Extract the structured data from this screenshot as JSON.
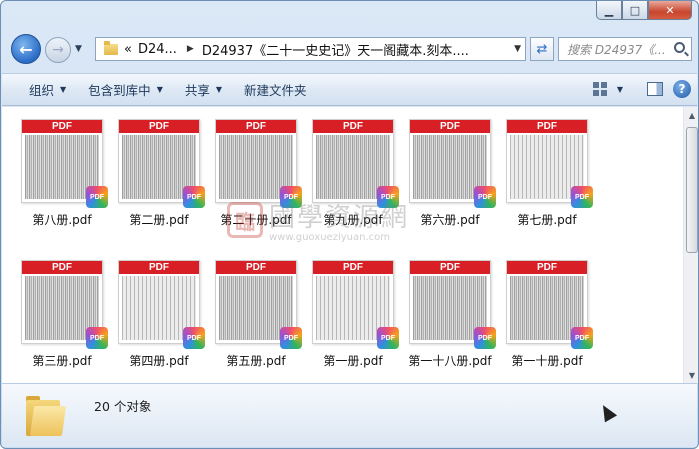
{
  "window": {
    "minimize_label": "▁",
    "maximize_label": "□",
    "close_label": "✕"
  },
  "address": {
    "overflow": "«",
    "crumb1": "D24...",
    "crumb2": "D24937《二十一史史记》天一阁藏本.刻本....",
    "search_placeholder": "搜索 D24937《..."
  },
  "toolbar": {
    "organize": "组织",
    "include_library": "包含到库中",
    "share": "共享",
    "new_folder": "新建文件夹"
  },
  "files": [
    {
      "name": "第八册.pdf"
    },
    {
      "name": "第二册.pdf"
    },
    {
      "name": "第二十册.pdf"
    },
    {
      "name": "第九册.pdf"
    },
    {
      "name": "第六册.pdf"
    },
    {
      "name": "第七册.pdf"
    },
    {
      "name": "第三册.pdf"
    },
    {
      "name": "第四册.pdf"
    },
    {
      "name": "第五册.pdf"
    },
    {
      "name": "第一册.pdf"
    },
    {
      "name": "第一十八册.pdf"
    },
    {
      "name": "第一十册.pdf"
    }
  ],
  "thumb_label": "PDF",
  "badge_label": "PDF",
  "watermark": {
    "seal": "臨",
    "title": "國學資源網",
    "url": "www.guoxueziyuan.com"
  },
  "status": {
    "count": "20 个对象"
  }
}
